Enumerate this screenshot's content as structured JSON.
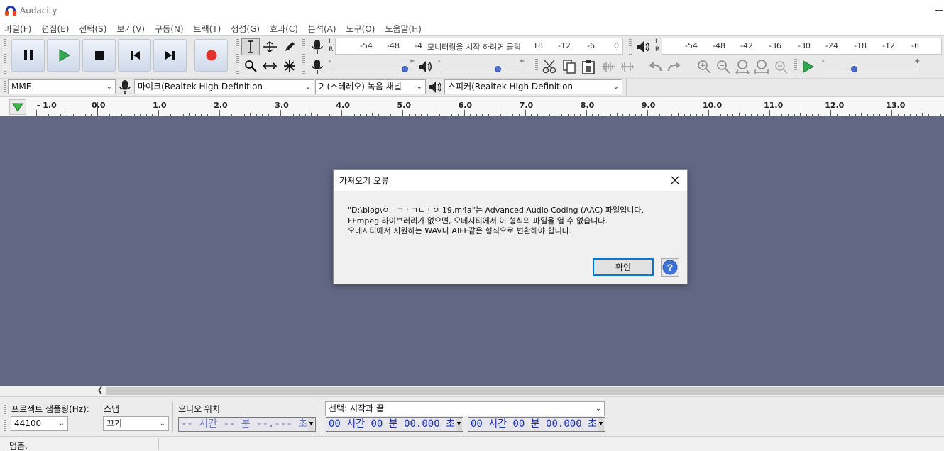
{
  "window": {
    "title": "Audacity"
  },
  "menu": [
    {
      "id": "file",
      "label": "파일(F)"
    },
    {
      "id": "edit",
      "label": "편집(E)"
    },
    {
      "id": "select",
      "label": "선택(S)"
    },
    {
      "id": "view",
      "label": "보기(V)"
    },
    {
      "id": "transport",
      "label": "구동(N)"
    },
    {
      "id": "tracks",
      "label": "트랙(T)"
    },
    {
      "id": "generate",
      "label": "생성(G)"
    },
    {
      "id": "effect",
      "label": "효과(C)"
    },
    {
      "id": "analyze",
      "label": "분석(A)"
    },
    {
      "id": "tools",
      "label": "도구(O)"
    },
    {
      "id": "help",
      "label": "도움말(H)"
    }
  ],
  "transport": {
    "buttons": [
      "pause-icon",
      "play-icon",
      "stop-icon",
      "skip-start-icon",
      "skip-end-icon",
      "record-icon"
    ]
  },
  "recording_meter": {
    "channels": [
      "L",
      "R"
    ],
    "scale_labels": [
      "-54",
      "-48",
      "-4",
      "18",
      "-12",
      "-6",
      "0"
    ],
    "prompt": "모니터링을 시작 하려면 클릭"
  },
  "playback_meter": {
    "channels": [
      "L",
      "R"
    ],
    "scale_labels": [
      "-54",
      "-48",
      "-42",
      "-36",
      "-30",
      "-24",
      "-18",
      "-12",
      "-6"
    ]
  },
  "sliders": {
    "recording_volume": {
      "minus": "-",
      "plus": "+",
      "level": 0.9
    },
    "playback_volume": {
      "minus": "-",
      "plus": "+",
      "level": 0.7
    },
    "play_at_speed": {
      "minus": "-",
      "plus": "+",
      "level": 0.33
    }
  },
  "devices": {
    "host": "MME",
    "recording_device": "마이크(Realtek High Definition",
    "channels": "2 (스테레오) 녹음 채널",
    "playback_device": "스피커(Realtek High Definition"
  },
  "ruler": {
    "labels": [
      "- 1.0",
      "0.0",
      "1.0",
      "2.0",
      "3.0",
      "4.0",
      "5.0",
      "6.0",
      "7.0",
      "8.0",
      "9.0",
      "10.0",
      "11.0",
      "12.0",
      "13.0"
    ]
  },
  "dialog": {
    "title": "가져오기 오류",
    "message_lines": [
      "\"D:\\blog\\ㅇㅗㄱㅗㄱㄷㅗㅇ 19.m4a\"는 Advanced Audio Coding (AAC) 파일입니다.",
      "FFmpeg 라이브러리가 없으면, 오데시티에서 이 형식의 파일을 열 수 없습니다.",
      "오데시티에서 지원하는 WAV나 AIFF같은 형식으로 변환해야 합니다."
    ],
    "ok_label": "확인",
    "help_label": "?"
  },
  "selection_bar": {
    "rate_label": "프로젝트 샘플링(Hz):",
    "rate_value": "44100",
    "snap_label": "스냅",
    "snap_value": "끄기",
    "audio_position_label": "오디오 위치",
    "audio_position_value": "-- 시간 -- 분 --.--- 초",
    "selection_mode": "선택: 시작과 끝",
    "selection_start": "00 시간 00 분 00.000 초",
    "selection_end": "00 시간 00 분 00.000 초"
  },
  "status": {
    "text": "멈춤."
  },
  "colors": {
    "track_background": "#626884",
    "play_green": "#2fa84f",
    "record_red": "#e0332e",
    "time_digits": "#1b2fb5",
    "accent_blue": "#0078d7"
  }
}
